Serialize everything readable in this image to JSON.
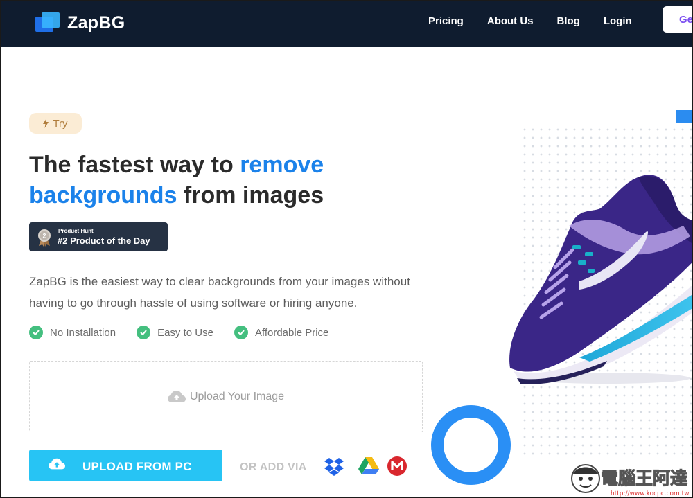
{
  "navbar": {
    "brand": "ZapBG",
    "links": [
      "Pricing",
      "About Us",
      "Blog",
      "Login"
    ],
    "cta": "Ge"
  },
  "hero": {
    "try_label": "Try",
    "headline_part1": "The fastest way to ",
    "headline_highlight1": "remove",
    "headline_highlight2": "backgrounds",
    "headline_part2": " from images",
    "product_hunt": {
      "small": "Product Hunt",
      "big": "#2 Product of the Day",
      "medal_number": "2"
    },
    "description": "ZapBG is the easiest way to clear backgrounds from your images without having to go through hassle of using software or hiring anyone.",
    "features": [
      "No Installation",
      "Easy to Use",
      "Affordable Price"
    ],
    "dropzone_label": "Upload Your Image",
    "upload_button": "UPLOAD FROM PC",
    "or_add_via": "OR ADD VIA",
    "services": [
      "dropbox-icon",
      "google-drive-icon",
      "mega-icon"
    ]
  },
  "watermark": {
    "title": "電腦王阿達",
    "url": "http://www.kocpc.com.tw"
  },
  "colors": {
    "navbar": "#0f1c2f",
    "accent": "#1b82ea",
    "upload": "#27c4f4",
    "check": "#44bf7f"
  }
}
